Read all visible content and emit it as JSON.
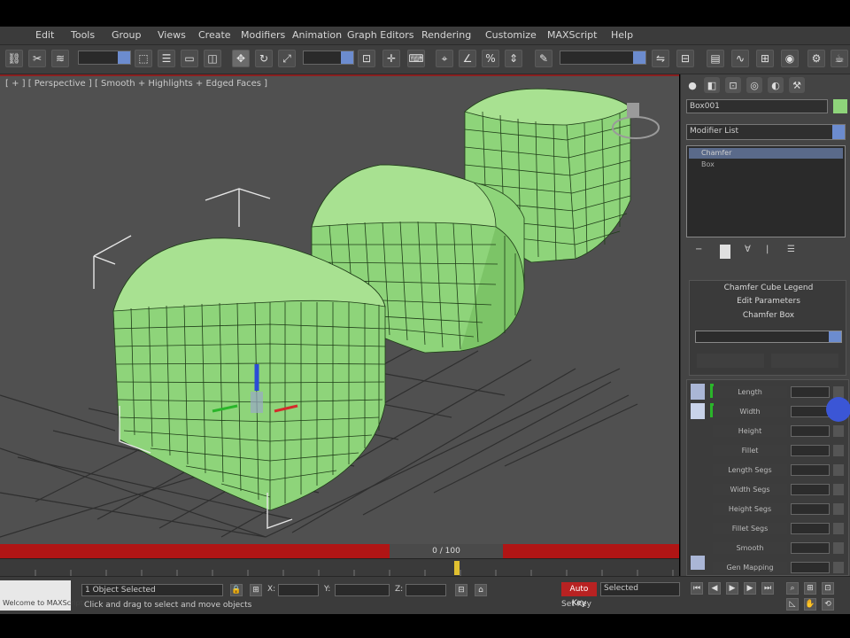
{
  "menu": [
    "Edit",
    "Tools",
    "Group",
    "Views",
    "Create",
    "Modifiers",
    "Animation",
    "Graph Editors",
    "Rendering",
    "Customize",
    "MAXScript",
    "Help"
  ],
  "viewport": {
    "label": "[ + ] [ Perspective ] [ Smooth + Highlights + Edged Faces ]"
  },
  "command_panel": {
    "tabs": [
      "create-tab",
      "modify-tab",
      "hierarchy-tab",
      "motion-tab",
      "display-tab",
      "utilities-tab"
    ],
    "object_name": "Box001",
    "object_color": "#8ed47a",
    "modifier_list_label": "Modifier List",
    "stack_items": [
      "Chamfer",
      "Box"
    ],
    "rollout_titles": [
      "Chamfer Cube Legend",
      "Edit Parameters",
      "Chamfer Box"
    ],
    "modifier_rows": [
      "Length",
      "Width",
      "Height",
      "Fillet",
      "Length Segs",
      "Width Segs",
      "Height Segs",
      "Fillet Segs",
      "Smooth",
      "Gen Mapping"
    ]
  },
  "timeline": {
    "slider_text": "0 / 100",
    "bar_color": "#b01515"
  },
  "status": {
    "selection_text": "1 Object Selected",
    "prompt_text": "Click and drag to select and move objects",
    "x_label": "X:",
    "y_label": "Y:",
    "z_label": "Z:",
    "auto_key_label": "Auto Key",
    "set_key_label": "Set Key",
    "selected_label": "Selected",
    "maxscript_label": "Welcome to MAXScript"
  },
  "colors": {
    "object_green": "#8ed47a",
    "viewport_bg": "#505050",
    "accent_red": "#b01515"
  }
}
